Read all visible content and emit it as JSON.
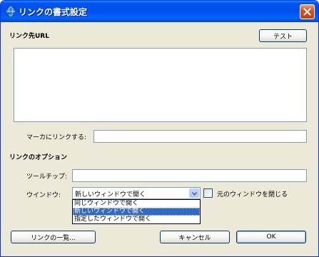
{
  "window": {
    "title": "リンクの書式設定",
    "icon": "app-globe-icon",
    "close_icon": "close-icon"
  },
  "link_url": {
    "section_label": "リンク先URL",
    "test_button": "テスト",
    "url_value": ""
  },
  "anchor": {
    "label": "マーカにリンクする:",
    "value": ""
  },
  "options": {
    "section_label": "リンクのオプション",
    "tooltip_label": "ツールチップ:",
    "tooltip_value": "",
    "window_label": "ウインドウ:",
    "window_selected": "新しいウィンドウで開く",
    "window_options": [
      "同じウィンドウで開く",
      "新しいウィンドウで開く",
      "指定したウィンドウで開く"
    ],
    "close_original_label": "元のウィンドウを閉じる",
    "close_original_checked": false
  },
  "buttons": {
    "link_list": "リンクの一覧...",
    "cancel": "キャンセル",
    "ok": "OK"
  },
  "colors": {
    "title_bar": "#0053ee",
    "dialog_bg": "#ece9d8",
    "selection": "#316ac5",
    "field_border": "#7f9db9"
  }
}
